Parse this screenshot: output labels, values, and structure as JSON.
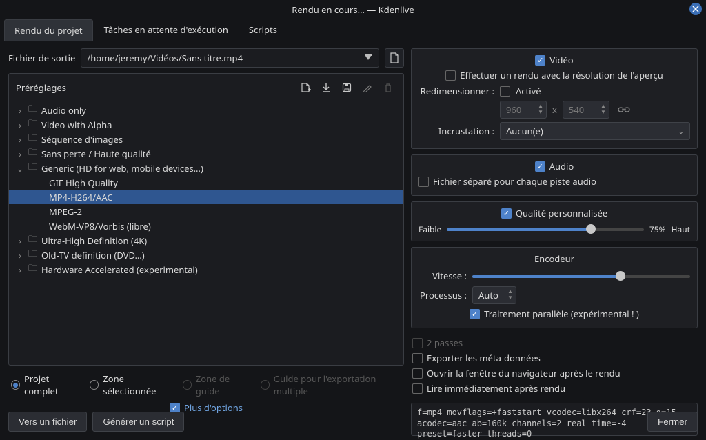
{
  "window": {
    "title": "Rendu en cours… — Kdenlive"
  },
  "tabs": {
    "project": "Rendu du projet",
    "queue": "Tâches en attente d'exécution",
    "scripts": "Scripts"
  },
  "file": {
    "label": "Fichier de sortie",
    "value": "/home/jeremy/Vidéos/Sans titre.mp4"
  },
  "presets": {
    "label": "Préréglages",
    "items": {
      "audio": "Audio only",
      "alpha": "Video with Alpha",
      "imgseq": "Séquence d'images",
      "lossless": "Sans perte / Haute qualité",
      "generic": "Generic (HD for web, mobile devices…)",
      "gif": "GIF High Quality",
      "mp4": "MP4-H264/AAC",
      "mpeg2": "MPEG-2",
      "webm": "WebM-VP8/Vorbis (libre)",
      "uhd": "Ultra-High Definition (4K)",
      "oldtv": "Old-TV definition (DVD…)",
      "hw": "Hardware Accelerated (experimental)"
    }
  },
  "range": {
    "full": "Projet complet",
    "zone": "Zone sélectionnée",
    "guide": "Zone de guide",
    "multi": "Guide pour l'exportation multiple"
  },
  "more": {
    "label": "Plus d'options"
  },
  "buttons": {
    "tofile": "Vers un fichier",
    "script": "Générer un script",
    "close": "Fermer"
  },
  "video": {
    "label": "Vidéo",
    "preview_res": "Effectuer un rendu avec la résolution de l'aperçu",
    "resize_lbl": "Redimensionner :",
    "enable": "Activé",
    "w": "960",
    "x": "x",
    "h": "540",
    "overlay_lbl": "Incrustation :",
    "overlay_val": "Aucun(e)"
  },
  "audio": {
    "label": "Audio",
    "sep": "Fichier séparé pour chaque piste audio"
  },
  "quality": {
    "label": "Qualité personnalisée",
    "low": "Faible",
    "pct": "75%",
    "high": "Haut"
  },
  "encoder": {
    "label": "Encodeur",
    "speed": "Vitesse :",
    "threads": "Processus :",
    "threads_val": "Auto",
    "parallel": "Traitement parallèle (expérimental ! )"
  },
  "opts": {
    "two_pass": "2 passes",
    "meta": "Exporter les méta-données",
    "browser": "Ouvrir la fenêtre du navigateur après le rendu",
    "play": "Lire immédiatement après rendu"
  },
  "cmd": "f=mp4 movflags=+faststart vcodec=libx264 crf=23 g=15 acodec=aac ab=160k channels=2 real_time=-4 preset=faster threads=0"
}
